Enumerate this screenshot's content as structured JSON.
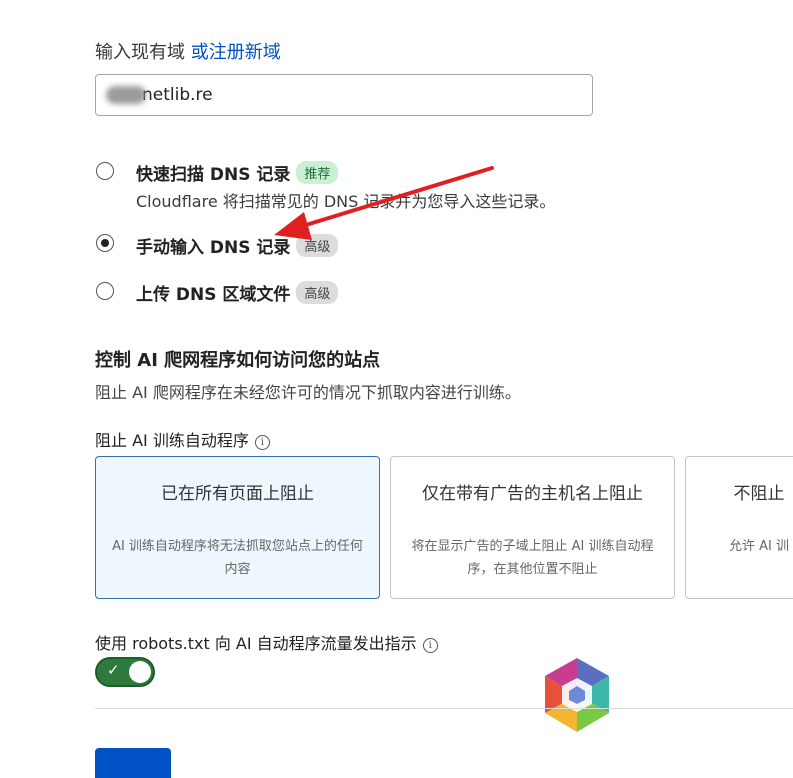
{
  "domain": {
    "label": "输入现有域",
    "register_link": "或注册新域",
    "input_value": "netlib.re"
  },
  "dns_options": [
    {
      "title": "快速扫描 DNS 记录",
      "badge": "推荐",
      "desc": "Cloudflare 将扫描常见的 DNS 记录并为您导入这些记录。",
      "checked": false
    },
    {
      "title": "手动输入 DNS 记录",
      "badge": "高级",
      "checked": true
    },
    {
      "title": "上传 DNS 区域文件",
      "badge": "高级",
      "checked": false
    }
  ],
  "ai_crawl": {
    "title": "控制 AI 爬网程序如何访问您的站点",
    "desc": "阻止 AI 爬网程序在未经您许可的情况下抓取内容进行训练。",
    "block_label": "阻止 AI 训练自动程序",
    "cards": [
      {
        "title": "已在所有页面上阻止",
        "desc": "AI 训练自动程序将无法抓取您站点上的任何内容",
        "selected": true
      },
      {
        "title": "仅在带有广告的主机名上阻止",
        "desc": "将在显示广告的子域上阻止 AI 训练自动程序，在其他位置不阻止",
        "selected": false
      },
      {
        "title": "不阻止",
        "desc": "允许 AI 训",
        "selected": false
      }
    ],
    "robots_label": "使用 robots.txt 向 AI 自动程序流量发出指示",
    "robots_enabled": true
  },
  "icons": {
    "info": "info-icon",
    "check": "check-icon",
    "arrow": "red-arrow-annotation",
    "logo": "hexagon-logo-watermark"
  },
  "colors": {
    "link": "#0051c3",
    "toggle_on": "#2c7a3c",
    "badge_green": "#c9f0d2",
    "badge_gray": "#dcdcdc",
    "card_selected_bg": "#eef6fe",
    "arrow": "#e02020"
  }
}
